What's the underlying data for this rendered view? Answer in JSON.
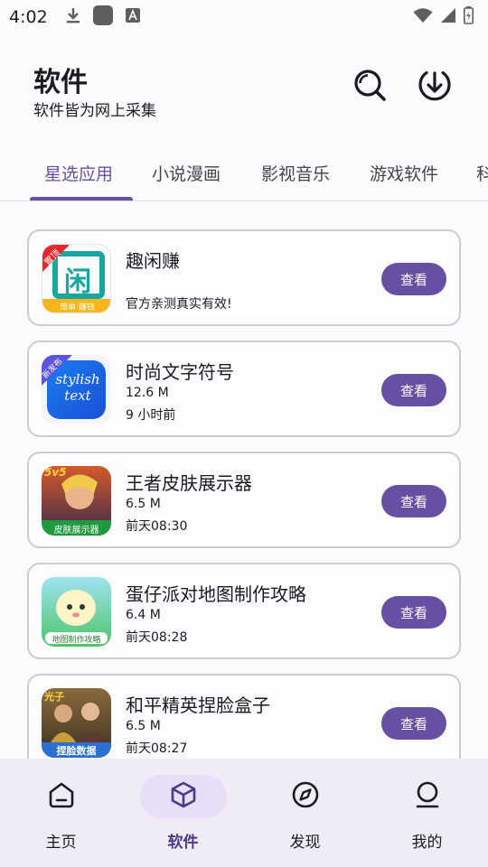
{
  "status_bar": {
    "time": "4:02",
    "icons_left": [
      "download-icon",
      "app-square-icon",
      "a-badge-icon"
    ],
    "icons_right": [
      "wifi-icon",
      "cell-signal-icon",
      "battery-icon"
    ]
  },
  "header": {
    "title": "软件",
    "subtitle": "软件皆为网上采集",
    "actions": [
      "search-icon",
      "download-circle-icon"
    ]
  },
  "tabs": [
    {
      "label": "星选应用",
      "active": true
    },
    {
      "label": "小说漫画",
      "active": false
    },
    {
      "label": "影视音乐",
      "active": false
    },
    {
      "label": "游戏软件",
      "active": false
    },
    {
      "label": "科",
      "active": false
    }
  ],
  "apps": [
    {
      "name": "趣闲赚",
      "line1": "",
      "line2": "官方亲测真实有效!",
      "button": "查看",
      "icon_text": "闲",
      "icon_badge": "置顶",
      "icon_caption": "简单·赚钱"
    },
    {
      "name": "时尚文字符号",
      "line1": "12.6 M",
      "line2": "9 小时前",
      "button": "查看",
      "icon_text": "stylish text",
      "icon_badge": "新发布"
    },
    {
      "name": "王者皮肤展示器",
      "line1": "6.5 M",
      "line2": "前天08:30",
      "button": "查看",
      "icon_badge": "5v5",
      "icon_caption": "皮肤展示器"
    },
    {
      "name": "蛋仔派对地图制作攻略",
      "line1": "6.4 M",
      "line2": "前天08:28",
      "button": "查看",
      "icon_caption": "地图制作攻略"
    },
    {
      "name": "和平精英捏脸盒子",
      "line1": "6.5 M",
      "line2": "前天08:27",
      "button": "查看",
      "icon_badge": "光子",
      "icon_caption": "捏脸数据"
    }
  ],
  "bottom_nav": [
    {
      "label": "主页",
      "icon": "home-icon",
      "active": false
    },
    {
      "label": "软件",
      "icon": "cube-icon",
      "active": true
    },
    {
      "label": "发现",
      "icon": "compass-icon",
      "active": false
    },
    {
      "label": "我的",
      "icon": "user-icon",
      "active": false
    }
  ],
  "colors": {
    "accent": "#6750a4",
    "active_pill": "#e7def8",
    "nav_background": "#f0ecf6",
    "card_border": "#cfcbd3"
  }
}
